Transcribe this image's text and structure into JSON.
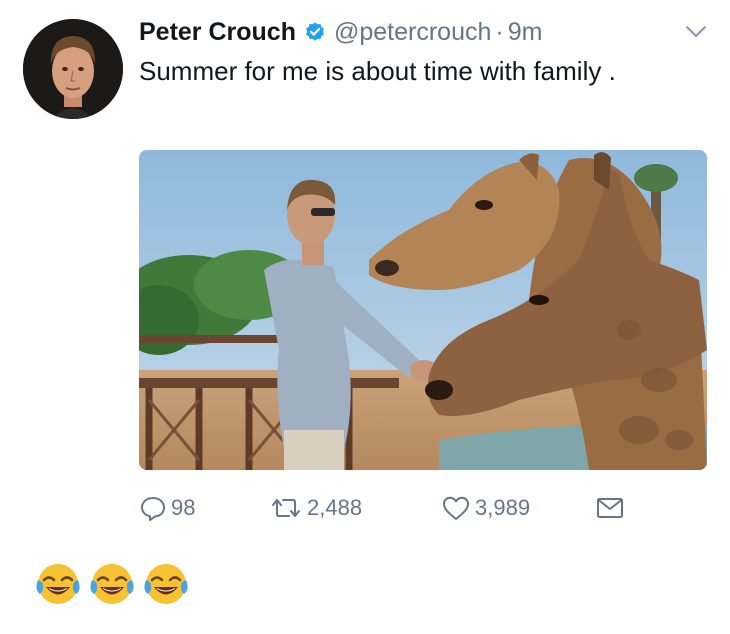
{
  "tweet": {
    "display_name": "Peter Crouch",
    "handle": "@petercrouch",
    "separator": "·",
    "time": "9m",
    "text": "Summer for me is about time with family .",
    "actions": {
      "replies": "98",
      "retweets": "2,488",
      "likes": "3,989"
    }
  },
  "colors": {
    "verified_blue": "#1da1f2",
    "secondary_text": "#657786",
    "primary_text": "#14171a"
  },
  "icons": [
    "verified-badge-icon",
    "chevron-down-icon",
    "reply-icon",
    "retweet-icon",
    "like-icon",
    "direct-message-icon",
    "tears-of-joy-emoji"
  ],
  "reaction": {
    "emoji": "😂😂😂",
    "emoji_count": 3
  }
}
